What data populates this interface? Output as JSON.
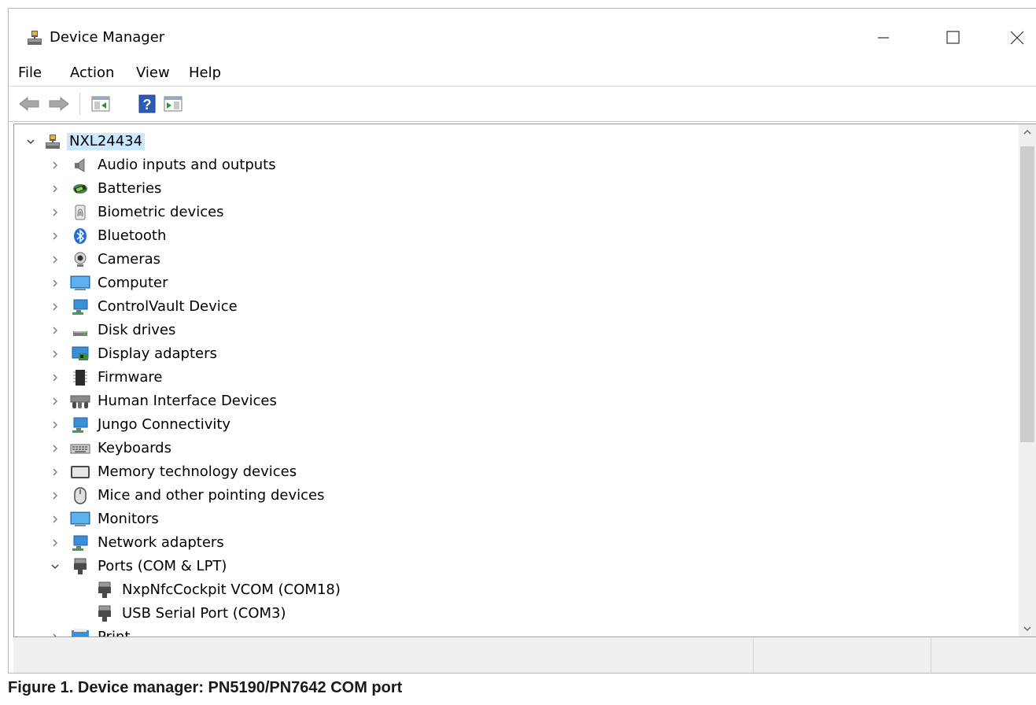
{
  "window": {
    "title": "Device Manager",
    "controls": [
      "minimize",
      "maximize",
      "close"
    ]
  },
  "menu": {
    "items": [
      "File",
      "Action",
      "View",
      "Help"
    ]
  },
  "toolbar": {
    "buttons": [
      {
        "name": "back",
        "icon": "arrow-left-icon"
      },
      {
        "name": "forward",
        "icon": "arrow-right-icon"
      },
      {
        "name": "show-hide-console-tree",
        "icon": "console-tree-icon"
      },
      {
        "name": "help",
        "icon": "help-icon"
      },
      {
        "name": "show-hide-action-pane",
        "icon": "action-pane-icon"
      }
    ]
  },
  "tree": {
    "root": {
      "label": "NXL24434",
      "icon": "computer-network-icon",
      "expanded": true,
      "selected": true
    },
    "categories": [
      {
        "label": "Audio inputs and outputs",
        "icon": "speaker-icon",
        "expanded": false
      },
      {
        "label": "Batteries",
        "icon": "battery-icon",
        "expanded": false
      },
      {
        "label": "Biometric devices",
        "icon": "fingerprint-icon",
        "expanded": false
      },
      {
        "label": "Bluetooth",
        "icon": "bluetooth-icon",
        "expanded": false
      },
      {
        "label": "Cameras",
        "icon": "camera-icon",
        "expanded": false
      },
      {
        "label": "Computer",
        "icon": "monitor-icon",
        "expanded": false
      },
      {
        "label": "ControlVault Device",
        "icon": "network-monitor-icon",
        "expanded": false
      },
      {
        "label": "Disk drives",
        "icon": "disk-drive-icon",
        "expanded": false
      },
      {
        "label": "Display adapters",
        "icon": "display-adapter-icon",
        "expanded": false
      },
      {
        "label": "Firmware",
        "icon": "chip-icon",
        "expanded": false
      },
      {
        "label": "Human Interface Devices",
        "icon": "hid-icon",
        "expanded": false
      },
      {
        "label": "Jungo Connectivity",
        "icon": "network-monitor-icon",
        "expanded": false
      },
      {
        "label": "Keyboards",
        "icon": "keyboard-icon",
        "expanded": false
      },
      {
        "label": "Memory technology devices",
        "icon": "memory-card-icon",
        "expanded": false
      },
      {
        "label": "Mice and other pointing devices",
        "icon": "mouse-icon",
        "expanded": false
      },
      {
        "label": "Monitors",
        "icon": "monitor-icon",
        "expanded": false
      },
      {
        "label": "Network adapters",
        "icon": "network-monitor-icon",
        "expanded": false
      },
      {
        "label": "Ports (COM & LPT)",
        "icon": "port-icon",
        "expanded": true,
        "children": [
          {
            "label": "NxpNfcCockpit VCOM (COM18)",
            "icon": "port-icon"
          },
          {
            "label": "USB Serial Port (COM3)",
            "icon": "port-icon"
          }
        ]
      },
      {
        "label": "Print",
        "icon": "printer-icon",
        "expanded": false,
        "partially_visible": true
      }
    ]
  },
  "scrollbar": {
    "position_fraction": 0.0,
    "visible_fraction": 0.58
  },
  "caption": "Figure 1.  Device manager: PN5190/PN7642 COM port",
  "colors": {
    "selection": "#cce8ff",
    "frame": "#9a9a9a",
    "status_bg": "#f0f0f0"
  }
}
